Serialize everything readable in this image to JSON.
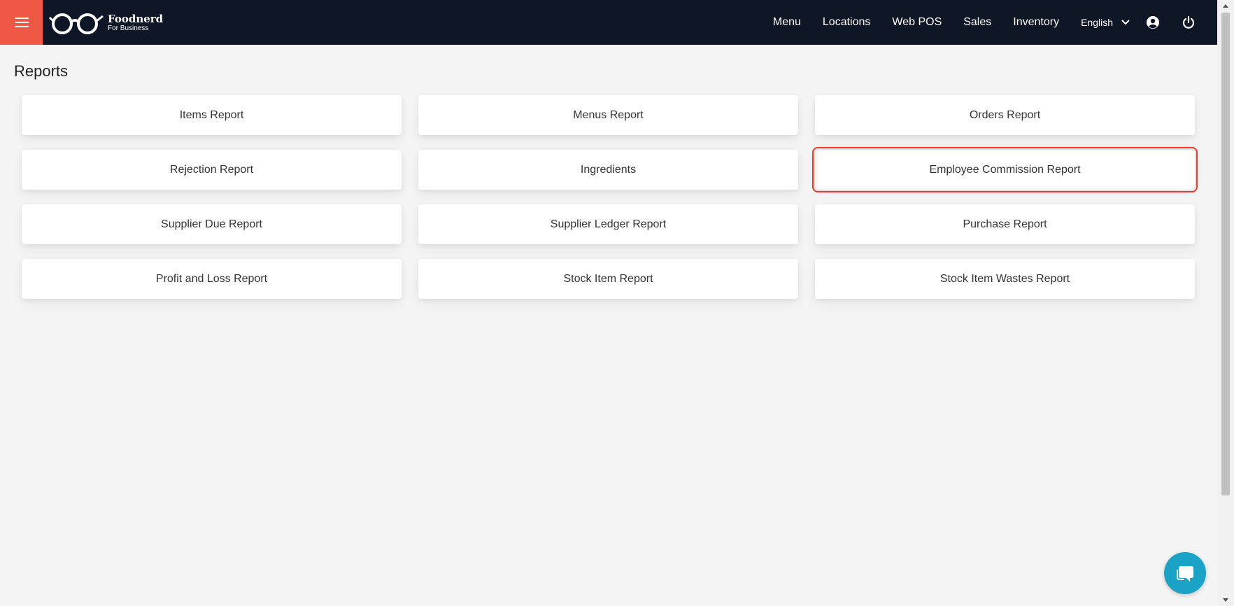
{
  "brand": {
    "name": "Foodnerd",
    "subtitle": "For Business"
  },
  "nav": {
    "items": [
      {
        "label": "Menu"
      },
      {
        "label": "Locations"
      },
      {
        "label": "Web POS"
      },
      {
        "label": "Sales"
      },
      {
        "label": "Inventory"
      }
    ],
    "language": "English"
  },
  "icons": {
    "menu": "hamburger-menu-icon",
    "user": "user-circle-icon",
    "power": "power-icon",
    "chat": "chat-icon"
  },
  "colors": {
    "topbar": "#0f1626",
    "hamburger": "#ef5845",
    "highlight": "#e53e2f",
    "chat": "#1aa3c7"
  },
  "page": {
    "title": "Reports"
  },
  "reports": [
    {
      "label": "Items Report"
    },
    {
      "label": "Menus Report"
    },
    {
      "label": "Orders Report"
    },
    {
      "label": "Rejection Report"
    },
    {
      "label": "Ingredients"
    },
    {
      "label": "Employee Commission Report"
    },
    {
      "label": "Supplier Due Report"
    },
    {
      "label": "Supplier Ledger Report"
    },
    {
      "label": "Purchase Report"
    },
    {
      "label": "Profit and Loss Report"
    },
    {
      "label": "Stock Item Report"
    },
    {
      "label": "Stock Item Wastes Report"
    }
  ]
}
